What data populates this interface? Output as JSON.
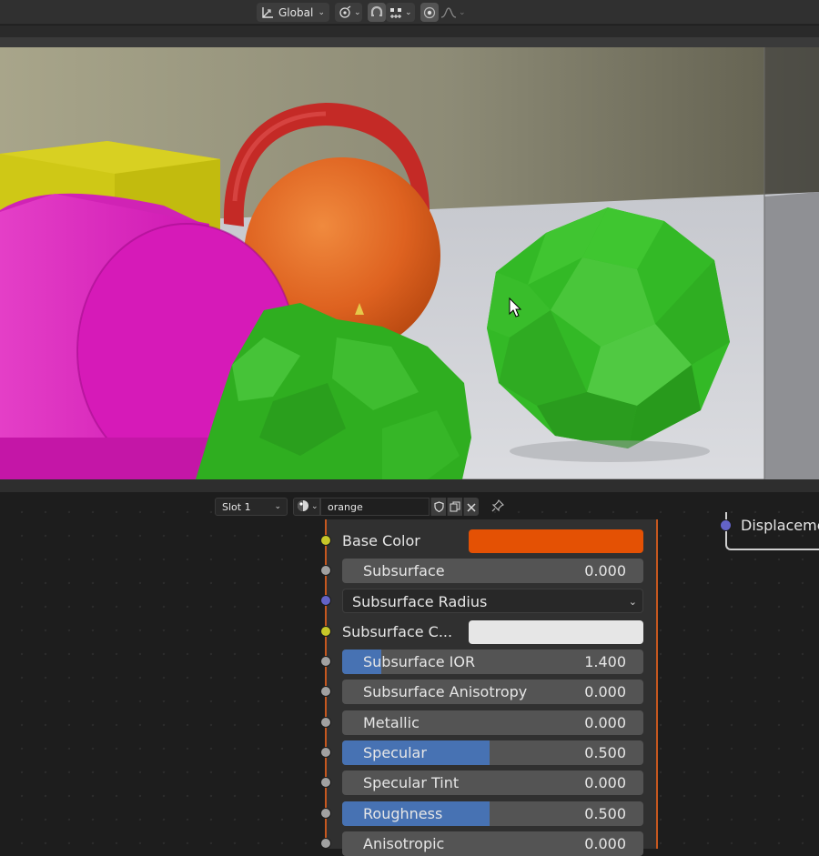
{
  "header": {
    "orientation_label": "Global",
    "icons": [
      "transform-orientation-icon",
      "pivot-icon",
      "snap-icon",
      "snap-increment-icon",
      "proportional-edit-icon",
      "falloff-icon"
    ]
  },
  "viewport": {
    "objects": [
      "yellow-cube",
      "magenta-cylinder",
      "red-torus",
      "orange-sphere",
      "green-monkey",
      "green-icosphere",
      "floor-plane"
    ]
  },
  "node_editor": {
    "slot_label": "Slot 1",
    "material_name": "orange",
    "displacement_label": "Displacement",
    "inputs": [
      {
        "kind": "color",
        "label": "Base Color",
        "socket": "yellow",
        "color": "#e45104"
      },
      {
        "kind": "slider",
        "label": "Subsurface",
        "value": "0.000",
        "socket": "gray",
        "fill": 0
      },
      {
        "kind": "dropdown",
        "label": "Subsurface Radius",
        "socket": "blue"
      },
      {
        "kind": "color",
        "label": "Subsurface C...",
        "socket": "yellow",
        "color": "#e6e6e6"
      },
      {
        "kind": "slider",
        "label": "Subsurface IOR",
        "value": "1.400",
        "socket": "gray",
        "fill": 0.13
      },
      {
        "kind": "slider",
        "label": "Subsurface Anisotropy",
        "value": "0.000",
        "socket": "gray",
        "fill": 0
      },
      {
        "kind": "slider",
        "label": "Metallic",
        "value": "0.000",
        "socket": "gray",
        "fill": 0
      },
      {
        "kind": "slider",
        "label": "Specular",
        "value": "0.500",
        "socket": "gray",
        "fill": 0.5
      },
      {
        "kind": "slider",
        "label": "Specular Tint",
        "value": "0.000",
        "socket": "gray",
        "fill": 0
      },
      {
        "kind": "slider",
        "label": "Roughness",
        "value": "0.500",
        "socket": "gray",
        "fill": 0.5
      },
      {
        "kind": "slider",
        "label": "Anisotropic",
        "value": "0.000",
        "socket": "gray",
        "fill": 0
      }
    ]
  },
  "colors": {
    "node_border": "#c7581f",
    "slider_fill": "#4772b3",
    "socket_yellow": "#c7c729",
    "socket_gray": "#a1a1a1",
    "socket_blue": "#6363c7"
  }
}
